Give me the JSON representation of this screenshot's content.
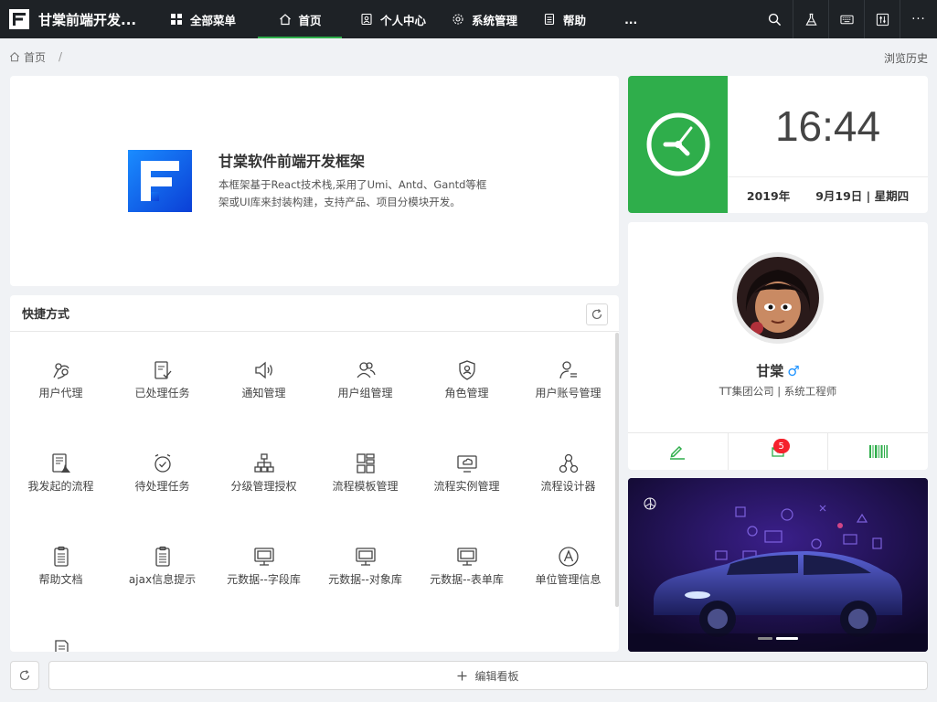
{
  "app": {
    "title": "甘棠前端开发..."
  },
  "menu": [
    {
      "label": "全部菜单",
      "icon": "grid-icon"
    },
    {
      "label": "首页",
      "icon": "home-icon",
      "active": true
    },
    {
      "label": "个人中心",
      "icon": "user-center-icon"
    },
    {
      "label": "系统管理",
      "icon": "gear-icon"
    },
    {
      "label": "帮助",
      "icon": "document-icon"
    },
    {
      "label": "..."
    }
  ],
  "tools": [
    "search-icon",
    "flask-icon",
    "keyboard-icon",
    "sliders-icon",
    "more-icon"
  ],
  "tools_more_label": "···",
  "breadcrumb": {
    "home": "首页",
    "separator": "/",
    "history": "浏览历史"
  },
  "intro": {
    "title": "甘棠软件前端开发框架",
    "desc": "本框架基于React技术栈,采用了Umi、Antd、Gantd等框架或UI库来封装构建，支持产品、项目分模块开发。"
  },
  "shortcuts": {
    "title": "快捷方式",
    "items": [
      {
        "label": "用户代理",
        "icon": "proxy-icon"
      },
      {
        "label": "已处理任务",
        "icon": "task-done-icon"
      },
      {
        "label": "通知管理",
        "icon": "speaker-icon"
      },
      {
        "label": "用户组管理",
        "icon": "users-icon"
      },
      {
        "label": "角色管理",
        "icon": "shield-user-icon"
      },
      {
        "label": "用户账号管理",
        "icon": "user-account-icon"
      },
      {
        "label": "我发起的流程",
        "icon": "flow-doc-icon"
      },
      {
        "label": "待处理任务",
        "icon": "alarm-clock-icon"
      },
      {
        "label": "分级管理授权",
        "icon": "hierarchy-icon"
      },
      {
        "label": "流程模板管理",
        "icon": "template-icon"
      },
      {
        "label": "流程实例管理",
        "icon": "monitor-cloud-icon"
      },
      {
        "label": "流程设计器",
        "icon": "nodes-icon"
      },
      {
        "label": "帮助文档",
        "icon": "clipboard-icon"
      },
      {
        "label": "ajax信息提示",
        "icon": "clipboard-icon"
      },
      {
        "label": "元数据--字段库",
        "icon": "monitor-icon"
      },
      {
        "label": "元数据--对象库",
        "icon": "monitor-icon"
      },
      {
        "label": "元数据--表单库",
        "icon": "monitor-icon"
      },
      {
        "label": "单位管理信息",
        "icon": "circle-a-icon"
      },
      {
        "label": "",
        "icon": "doc-edit-icon"
      }
    ]
  },
  "clock": {
    "time": "16:44",
    "year": "2019年",
    "date": "9月19日 | 星期四"
  },
  "profile": {
    "name": "甘棠",
    "gender_symbol": "♂",
    "subtitle": "TT集团公司 | 系统工程师",
    "message_count": "5"
  },
  "footer": {
    "edit_label": "编辑看板"
  },
  "colors": {
    "accent": "#2fae4b",
    "topbar": "#1e2226",
    "badge": "#f5222d",
    "brand_blue": "#1565e8"
  }
}
